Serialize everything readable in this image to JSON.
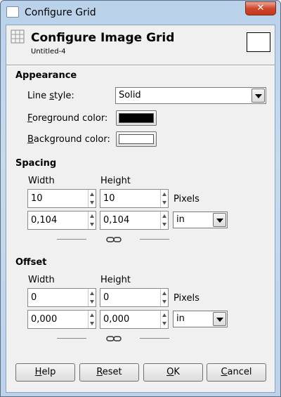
{
  "window": {
    "title": "Configure Grid",
    "close_label": "✕"
  },
  "header": {
    "title": "Configure Image Grid",
    "subtitle": "Untitled-4"
  },
  "appearance": {
    "section_title": "Appearance",
    "line_style": {
      "label_ul": "L",
      "label_rest": "ine style:",
      "value": "Solid",
      "label_pre": "Line ",
      "label_u": "s",
      "label_post": "tyle:"
    },
    "foreground": {
      "label_u": "F",
      "label_rest": "oreground color:",
      "color": "#000000"
    },
    "background": {
      "label_u": "B",
      "label_rest": "ackground color:",
      "color": "#ffffff"
    }
  },
  "spacing": {
    "section_title": "Spacing",
    "width_label": "Width",
    "height_label": "Height",
    "width_px": "10",
    "height_px": "10",
    "pixels_label": "Pixels",
    "width_unit_val": "0,104",
    "height_unit_val": "0,104",
    "unit": "in"
  },
  "offset": {
    "section_title": "Offset",
    "width_label": "Width",
    "height_label": "Height",
    "width_px": "0",
    "height_px": "0",
    "pixels_label": "Pixels",
    "width_unit_val": "0,000",
    "height_unit_val": "0,000",
    "unit": "in"
  },
  "buttons": {
    "help_u": "H",
    "help_rest": "elp",
    "reset_u": "R",
    "reset_rest": "eset",
    "ok_u": "O",
    "ok_rest": "K",
    "cancel_u": "C",
    "cancel_rest": "ancel"
  },
  "icons": {
    "app": "window-icon",
    "grid": "grid-icon",
    "chain": "chain-link-icon"
  }
}
